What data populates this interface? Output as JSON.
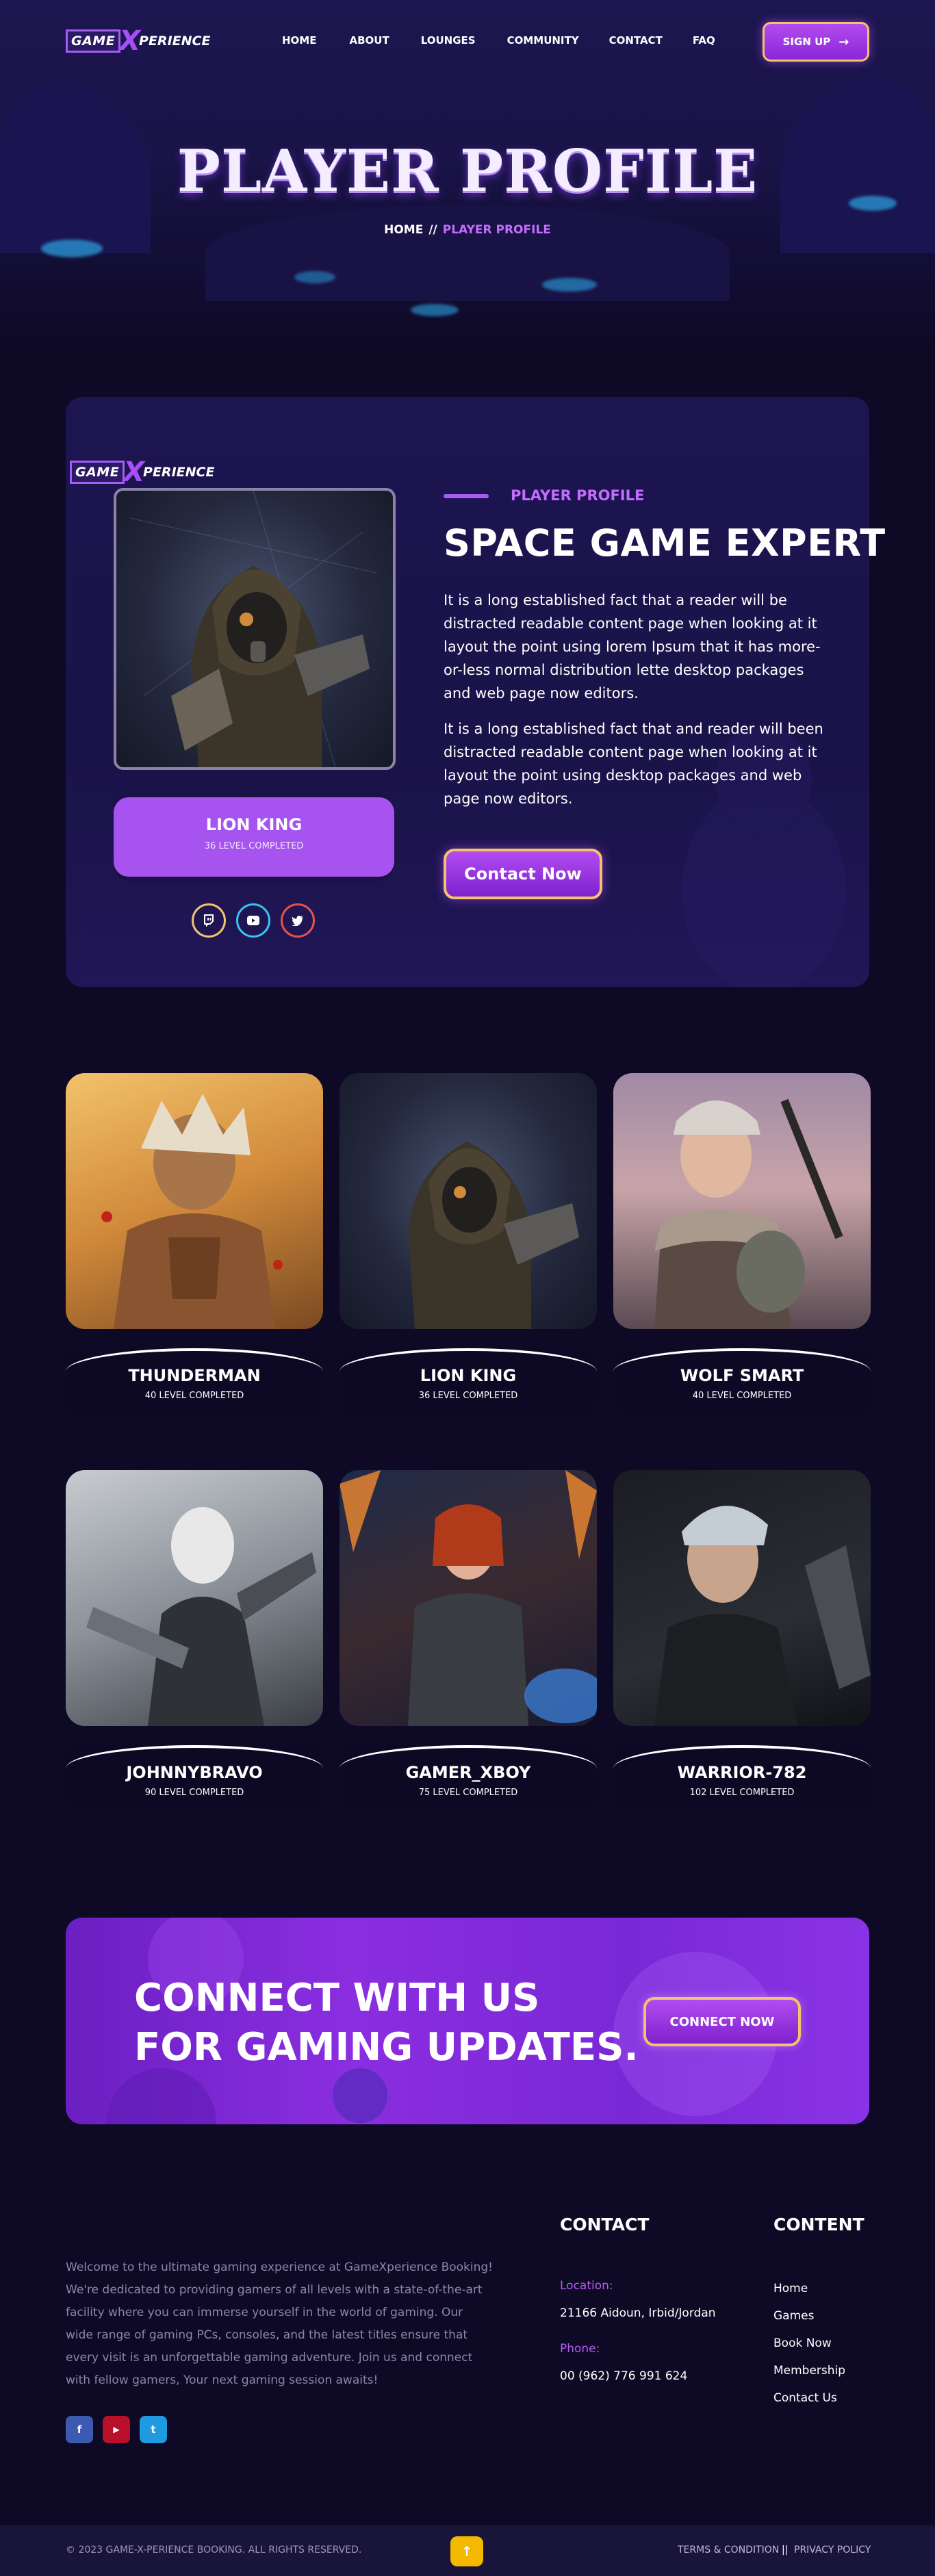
{
  "brand": {
    "logo_box": "GAME",
    "logo_x": "X",
    "logo_rest": "PERIENCE"
  },
  "nav": {
    "items": [
      "HOME",
      "ABOUT",
      "LOUNGES",
      "COMMUNITY",
      "CONTACT",
      "FAQ"
    ],
    "signup_label": "SIGN UP"
  },
  "hero": {
    "title": "PLAYER PROFILE",
    "breadcrumb_home": "HOME",
    "breadcrumb_sep": "//",
    "breadcrumb_current": "PLAYER PROFILE"
  },
  "profile": {
    "player_name": "LION KING",
    "player_level": "36 LEVEL COMPLETED",
    "eyebrow": "PLAYER PROFILE",
    "heading": "SPACE GAME EXPERT",
    "paragraph_1": "It is a long established fact that a reader will be distracted readable content page when looking at it layout the point using lorem Ipsum that it has more-or-less normal distribution lette desktop packages and web page now editors.",
    "paragraph_2": "It is a long established fact that and reader will been distracted readable content page when looking at it layout the point using desktop packages and web page now editors.",
    "contact_label": "Contact Now",
    "social": [
      {
        "icon": "twitch-icon",
        "color": "#f3c46b"
      },
      {
        "icon": "youtube-icon",
        "color": "#3cc2f0"
      },
      {
        "icon": "twitter-icon",
        "color": "#e2534b"
      }
    ]
  },
  "players": [
    {
      "name": "THUNDERMAN",
      "level": "40 LEVEL COMPLETED"
    },
    {
      "name": "LION KING",
      "level": "36 LEVEL COMPLETED"
    },
    {
      "name": "WOLF SMART",
      "level": "40 LEVEL COMPLETED"
    },
    {
      "name": "JOHNNYBRAVO",
      "level": "90 LEVEL COMPLETED"
    },
    {
      "name": "GAMER_XBOY",
      "level": "75 LEVEL COMPLETED"
    },
    {
      "name": "WARRIOR-782",
      "level": "102 LEVEL COMPLETED"
    }
  ],
  "cta": {
    "line_1": "CONNECT WITH US",
    "line_2": "FOR GAMING UPDATES.",
    "button_label": "CONNECT NOW"
  },
  "footer": {
    "about_text": "Welcome to the ultimate gaming experience at GameXperience Booking! We're dedicated to providing gamers of all levels with a state-of-the-art facility where you can immerse yourself in the world of gaming. Our wide range of gaming PCs, consoles, and the latest titles ensure that every visit is an unforgettable gaming adventure. Join us and connect with fellow gamers, Your next gaming session awaits!",
    "social_labels": [
      "f",
      "▶",
      "t"
    ],
    "contact_heading": "CONTACT",
    "location_label": "Location:",
    "location_value": "21166 Aidoun, Irbid/Jordan",
    "phone_label": "Phone:",
    "phone_value": "00 (962) 776 991 624",
    "content_heading": "CONTENT",
    "links": [
      "Home",
      "Games",
      "Book Now",
      "Membership",
      "Contact Us"
    ],
    "copyright": "© 2023 GAME-X-PERIENCE BOOKING. ALL RIGHTS RESERVED.",
    "terms": "TERMS & CONDITION",
    "legal_sep": "||",
    "privacy": "PRIVACY POLICY"
  },
  "colors": {
    "accent": "#a45cf4",
    "gold_border": "#f3c46b",
    "background": "#0e0a26"
  }
}
